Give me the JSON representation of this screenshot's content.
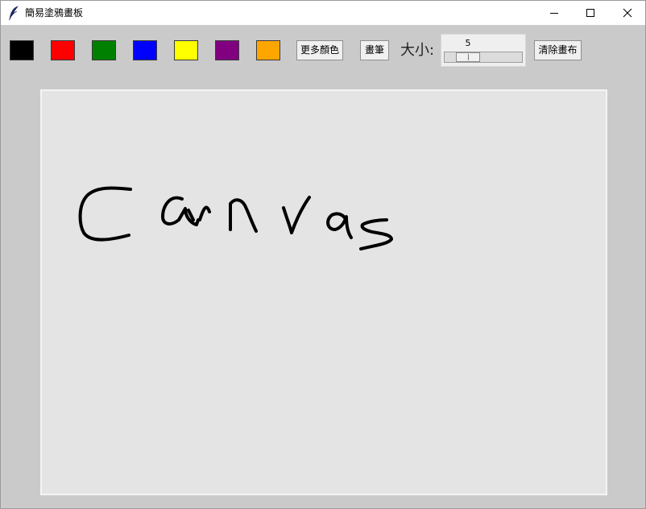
{
  "window": {
    "title": "簡易塗鴉畫板",
    "controls": {
      "minimize_icon": "minimize-icon",
      "maximize_icon": "maximize-icon",
      "close_icon": "close-icon"
    },
    "app_icon": "feather-icon"
  },
  "toolbar": {
    "color_swatches": [
      {
        "name": "black",
        "color": "#000000"
      },
      {
        "name": "red",
        "color": "#ff0000"
      },
      {
        "name": "green",
        "color": "#008000"
      },
      {
        "name": "blue",
        "color": "#0000ff"
      },
      {
        "name": "yellow",
        "color": "#ffff00"
      },
      {
        "name": "purple",
        "color": "#800080"
      },
      {
        "name": "orange",
        "color": "#ffa500"
      }
    ],
    "more_colors_label": "更多顏色",
    "brush_label": "畫筆",
    "size_label": "大小:",
    "size_value": "5",
    "size_min": 1,
    "size_max": 20,
    "clear_label": "清除畫布"
  },
  "canvas": {
    "background": "#e4e4e4",
    "stroke_color": "#000000",
    "drawn_content": "Canvas"
  }
}
